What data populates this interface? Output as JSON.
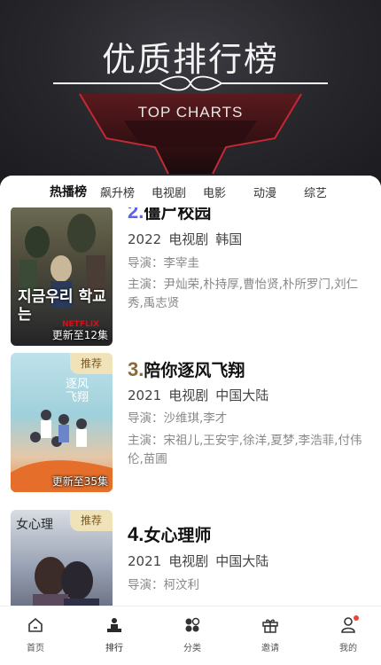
{
  "hero": {
    "title": "优质排行榜",
    "subtitle": "TOP CHARTS"
  },
  "tabs": [
    {
      "label": "热播榜",
      "active": true
    },
    {
      "label": "飙升榜",
      "active": false
    },
    {
      "label": "电视剧",
      "active": false
    },
    {
      "label": "电影",
      "active": false
    },
    {
      "label": "动漫",
      "active": false
    },
    {
      "label": "综艺",
      "active": false
    }
  ],
  "items": [
    {
      "rank": "2.",
      "rank_color": "#5b63e8",
      "title": "僵尸校园",
      "year": "2022",
      "category": "电视剧",
      "region": "韩国",
      "director": "导演：李宰圭",
      "cast": "主演：尹灿荣,朴持厚,曹怡贤,朴所罗门,刘仁秀,禹志贤",
      "caption": "更新至12集",
      "badge": "",
      "poster_text": "지금우리 학교는",
      "poster_netflix": "NETFLIX"
    },
    {
      "rank": "3.",
      "rank_color": "#8a6a3a",
      "title": "陪你逐风飞翔",
      "year": "2021",
      "category": "电视剧",
      "region": "中国大陆",
      "director": "导演：沙维琪,李才",
      "cast": "主演：宋祖儿,王安宇,徐洋,夏梦,李浩菲,付伟伦,苗圃",
      "caption": "更新至35集",
      "badge": "推荐",
      "poster_text": "逐风 飞翔"
    },
    {
      "rank": "4.",
      "rank_color": "#111111",
      "title": "女心理师",
      "year": "2021",
      "category": "电视剧",
      "region": "中国大陆",
      "director": "导演：柯汶利",
      "cast": "",
      "caption": "",
      "badge": "推荐",
      "poster_text": "女心理"
    }
  ],
  "bottom_nav": [
    {
      "label": "首页",
      "icon": "home-icon",
      "active": false
    },
    {
      "label": "排行",
      "icon": "ranking-icon",
      "active": true
    },
    {
      "label": "分类",
      "icon": "category-icon",
      "active": false
    },
    {
      "label": "邀请",
      "icon": "gift-icon",
      "active": false
    },
    {
      "label": "我的",
      "icon": "user-icon",
      "active": false,
      "dot": true
    }
  ],
  "colors": {
    "accent_purple": "#5b63e8",
    "badge_bg": "#f0e3b9",
    "notification_dot": "#e8453c"
  }
}
